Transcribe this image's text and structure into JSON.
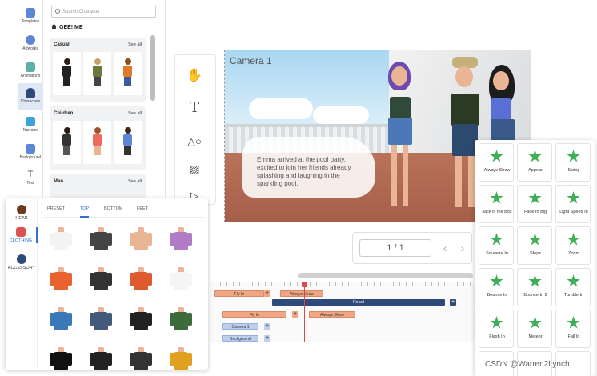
{
  "rail": {
    "items": [
      {
        "label": "Templates",
        "color": "#5b87d6"
      },
      {
        "label": "Artworks",
        "color": "#5b87d6"
      },
      {
        "label": "Animations",
        "color": "#5bb0a8"
      },
      {
        "label": "Characters",
        "color": "#2f4a7a"
      },
      {
        "label": "Narrator",
        "color": "#3aa4d8"
      },
      {
        "label": "Background",
        "color": "#5b87d6"
      },
      {
        "label": "Text",
        "color": "#555555"
      }
    ]
  },
  "characters": {
    "search_placeholder": "Search Character",
    "brand": "GEE! ME",
    "categories": [
      {
        "title": "Casual",
        "see_all": "See all"
      },
      {
        "title": "Children",
        "see_all": "See all"
      },
      {
        "title": "Man",
        "see_all": "See all"
      }
    ]
  },
  "stage": {
    "camera_label": "Camera 1",
    "caption": "Emma arrived at the pool party, excited to join her friends already splashing and laughing in the sparkling pool."
  },
  "pager": {
    "value": "1 / 1",
    "prev": "‹",
    "next": "›"
  },
  "timeline": {
    "bars": [
      {
        "label": "Fly In"
      },
      {
        "label": "Always Show"
      },
      {
        "label": "Recall"
      },
      {
        "label": "Fly In"
      },
      {
        "label": "Always Show"
      },
      {
        "label": "Camera 1"
      },
      {
        "label": "Background"
      }
    ],
    "plus": "+"
  },
  "clothing": {
    "side": [
      {
        "label": "HEAD"
      },
      {
        "label": "CLOTHING"
      },
      {
        "label": "ACCESSORY"
      }
    ],
    "tabs": [
      "PRESET",
      "TOP",
      "BOTTOM",
      "FEET"
    ]
  },
  "animations": {
    "items": [
      "Always Show",
      "Appear",
      "Swing",
      "Jack in the Box",
      "Fade In Big",
      "Light Speed In",
      "Squeeze In",
      "Steps",
      "Zoom",
      "Bounce In",
      "Bounce In 2",
      "Tumble In",
      "Flash In",
      "Meteor",
      "Fall In"
    ],
    "accent": "#3fae57"
  },
  "watermark": "CSDN @Warren2Lynch"
}
